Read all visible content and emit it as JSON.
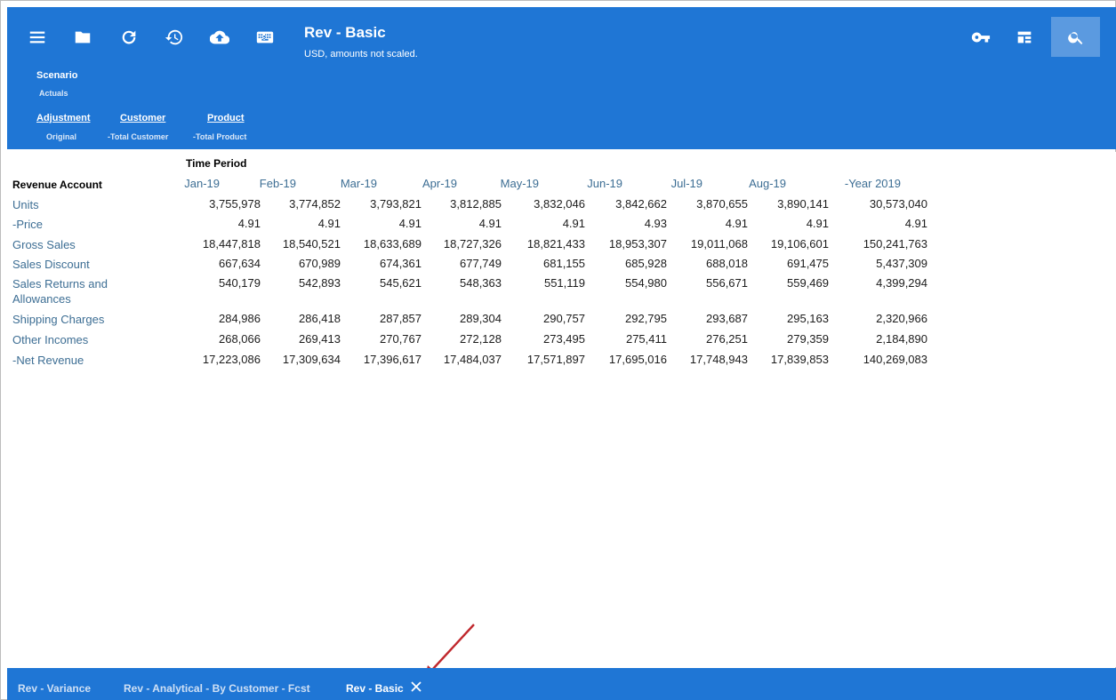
{
  "header": {
    "title": "Rev - Basic",
    "subtitle": "USD, amounts not scaled."
  },
  "toolbar": {
    "icons": [
      "menu-icon",
      "folder-icon",
      "refresh-icon",
      "history-icon",
      "cloud-upload-icon",
      "keyboard-icon",
      "key-icon",
      "layout-icon",
      "search-icon"
    ]
  },
  "pov": {
    "scenario": {
      "label": "Scenario",
      "value": "Actuals"
    },
    "adjustment": {
      "label": "Adjustment",
      "value": "Original"
    },
    "customer": {
      "label": "Customer",
      "value": "-Total Customer"
    },
    "product": {
      "label": "Product",
      "value": "-Total Product"
    }
  },
  "grid": {
    "column_dimension": "Time Period",
    "row_dimension": "Revenue Account",
    "columns": [
      "Jan-19",
      "Feb-19",
      "Mar-19",
      "Apr-19",
      "May-19",
      "Jun-19",
      "Jul-19",
      "Aug-19",
      "-Year 2019"
    ],
    "rows": [
      {
        "label": "Units",
        "values": [
          "3,755,978",
          "3,774,852",
          "3,793,821",
          "3,812,885",
          "3,832,046",
          "3,842,662",
          "3,870,655",
          "3,890,141",
          "30,573,040"
        ]
      },
      {
        "label": "-Price",
        "values": [
          "4.91",
          "4.91",
          "4.91",
          "4.91",
          "4.91",
          "4.93",
          "4.91",
          "4.91",
          "4.91"
        ]
      },
      {
        "label": "Gross Sales",
        "values": [
          "18,447,818",
          "18,540,521",
          "18,633,689",
          "18,727,326",
          "18,821,433",
          "18,953,307",
          "19,011,068",
          "19,106,601",
          "150,241,763"
        ]
      },
      {
        "label": "Sales Discount",
        "values": [
          "667,634",
          "670,989",
          "674,361",
          "677,749",
          "681,155",
          "685,928",
          "688,018",
          "691,475",
          "5,437,309"
        ]
      },
      {
        "label": "Sales Returns and Allowances",
        "values": [
          "540,179",
          "542,893",
          "545,621",
          "548,363",
          "551,119",
          "554,980",
          "556,671",
          "559,469",
          "4,399,294"
        ]
      },
      {
        "label": "Shipping Charges",
        "values": [
          "284,986",
          "286,418",
          "287,857",
          "289,304",
          "290,757",
          "292,795",
          "293,687",
          "295,163",
          "2,320,966"
        ]
      },
      {
        "label": "Other Incomes",
        "values": [
          "268,066",
          "269,413",
          "270,767",
          "272,128",
          "273,495",
          "275,411",
          "276,251",
          "279,359",
          "2,184,890"
        ]
      },
      {
        "label": "-Net Revenue",
        "values": [
          "17,223,086",
          "17,309,634",
          "17,396,617",
          "17,484,037",
          "17,571,897",
          "17,695,016",
          "17,748,943",
          "17,839,853",
          "140,269,083"
        ]
      }
    ]
  },
  "tabs": [
    {
      "label": "Rev - Variance",
      "active": false
    },
    {
      "label": "Rev - Analytical - By Customer - Fcst",
      "active": false
    },
    {
      "label": "Rev - Basic",
      "active": true
    }
  ],
  "colors": {
    "header_blue": "#1f76d5",
    "search_button": "#5b9ae0",
    "row_label": "#3d6e94",
    "annotation_arrow": "#c0282d"
  }
}
